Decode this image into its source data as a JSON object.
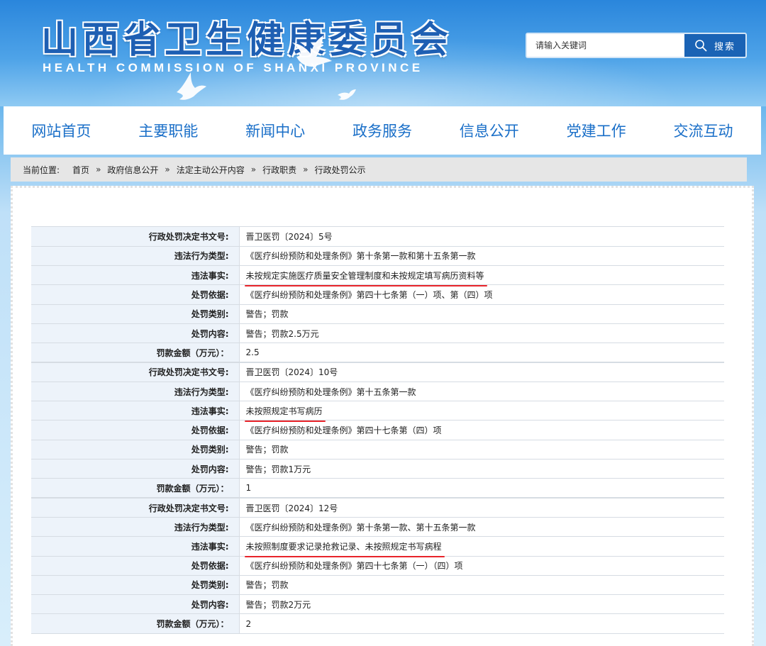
{
  "header": {
    "title": "山西省卫生健康委员会",
    "subtitle": "HEALTH COMMISSION OF SHANXI PROVINCE"
  },
  "search": {
    "placeholder": "请输入关键词",
    "button_label": "搜索",
    "icon": "search-icon"
  },
  "nav": {
    "items": [
      "网站首页",
      "主要职能",
      "新闻中心",
      "政务服务",
      "信息公开",
      "党建工作",
      "交流互动"
    ]
  },
  "breadcrumb": {
    "label": "当前位置:",
    "items": [
      "首页",
      "政府信息公开",
      "法定主动公开内容",
      "行政职责",
      "行政处罚公示"
    ],
    "separator": "»"
  },
  "labels": {
    "doc_no": "行政处罚决定书文号:",
    "violation_type": "违法行为类型:",
    "facts": "违法事实:",
    "basis": "处罚依据:",
    "category": "处罚类别:",
    "content": "处罚内容:",
    "amount": "罚款金额（万元）："
  },
  "records": [
    {
      "doc_no": "晋卫医罚〔2024〕5号",
      "violation_type": "《医疗纠纷预防和处理条例》第十条第一款和第十五条第一款",
      "facts": "未按规定实施医疗质量安全管理制度和未按规定填写病历资料等",
      "basis": "《医疗纠纷预防和处理条例》第四十七条第（一）项、第（四）项",
      "category": "警告；罚款",
      "content": "警告；罚款2.5万元",
      "amount": "2.5"
    },
    {
      "doc_no": "晋卫医罚〔2024〕10号",
      "violation_type": "《医疗纠纷预防和处理条例》第十五条第一款",
      "facts": "未按照规定书写病历",
      "basis": "《医疗纠纷预防和处理条例》第四十七条第（四）项",
      "category": "警告；罚款",
      "content": "警告；罚款1万元",
      "amount": "1"
    },
    {
      "doc_no": "晋卫医罚〔2024〕12号",
      "violation_type": "《医疗纠纷预防和处理条例》第十条第一款、第十五条第一款",
      "facts": "未按照制度要求记录抢救记录、未按照规定书写病程",
      "basis": "《医疗纠纷预防和处理条例》第四十七条第（一）（四）项",
      "category": "警告；罚款",
      "content": "警告；罚款2万元",
      "amount": "2"
    }
  ],
  "colors": {
    "nav_text": "#1a6fc8",
    "search_button": "#1a63b5",
    "label_bg": "#edf3fa",
    "underline_red": "#e8242a"
  }
}
